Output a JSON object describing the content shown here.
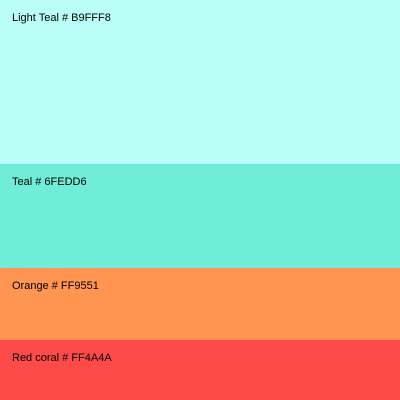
{
  "palette": {
    "swatches": [
      {
        "label": "Light Teal # B9FFF8",
        "color": "#B9FFF8"
      },
      {
        "label": "Teal # 6FEDD6",
        "color": "#6FEDD6"
      },
      {
        "label": "Orange # FF9551",
        "color": "#FF9551"
      },
      {
        "label": "Red coral # FF4A4A",
        "color": "#FF4A4A"
      }
    ]
  }
}
